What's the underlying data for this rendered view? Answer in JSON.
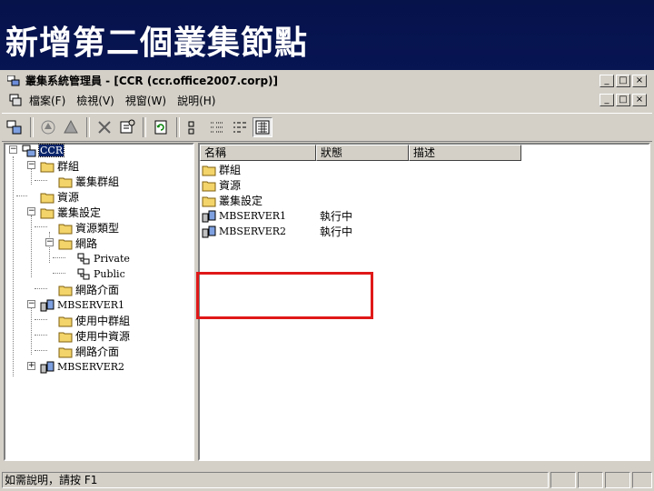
{
  "slide": {
    "title": "新增第二個叢集節點"
  },
  "window": {
    "title": "叢集系統管理員 - [CCR (ccr.office2007.corp)]"
  },
  "caption_buttons": {
    "minimize": "_",
    "maximize": "□",
    "close": "×"
  },
  "menu": {
    "items": [
      "檔案(F)",
      "檢視(V)",
      "視窗(W)",
      "說明(H)"
    ]
  },
  "tree": {
    "root": "CCR",
    "groups": "群組",
    "cluster_group": "叢集群組",
    "resources": "資源",
    "cluster_config": "叢集設定",
    "resource_types": "資源類型",
    "networks": "網路",
    "private": "Private",
    "public": "Public",
    "network_interfaces": "網路介面",
    "server1": "MBSERVER1",
    "active_groups": "使用中群組",
    "active_resources": "使用中資源",
    "server1_interfaces": "網路介面",
    "server2": "MBSERVER2"
  },
  "list": {
    "columns": [
      "名稱",
      "狀態",
      "描述"
    ],
    "rows": [
      {
        "name": "群組",
        "status": "",
        "desc": "",
        "icon": "folder-icon"
      },
      {
        "name": "資源",
        "status": "",
        "desc": "",
        "icon": "folder-icon"
      },
      {
        "name": "叢集設定",
        "status": "",
        "desc": "",
        "icon": "folder-icon"
      },
      {
        "name": "MBSERVER1",
        "status": "執行中",
        "desc": "",
        "icon": "server-node-icon"
      },
      {
        "name": "MBSERVER2",
        "status": "執行中",
        "desc": "",
        "icon": "server-node-icon"
      }
    ]
  },
  "status_bar": {
    "text": "如需說明，請按 F1"
  },
  "colors": {
    "highlight_box": "#e01818",
    "selection": "#0a246a",
    "slide_bg": "#0a1d6e",
    "chrome": "#d4d0c8"
  }
}
